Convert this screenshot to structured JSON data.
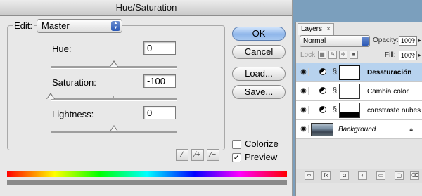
{
  "dialog": {
    "title": "Hue/Saturation",
    "edit_label": "Edit:",
    "edit_value": "Master",
    "hue_label": "Hue:",
    "hue_value": "0",
    "saturation_label": "Saturation:",
    "saturation_value": "-100",
    "lightness_label": "Lightness:",
    "lightness_value": "0",
    "slider_levels": {
      "hue": 0,
      "saturation": -100,
      "lightness": 0
    },
    "buttons": {
      "ok": "OK",
      "cancel": "Cancel",
      "load": "Load...",
      "save": "Save..."
    },
    "colorize_label": "Colorize",
    "colorize_checked": false,
    "preview_label": "Preview",
    "preview_checked": true,
    "check_mark": "✓"
  },
  "layers_panel": {
    "tab_label": "Layers",
    "tab_close": "×",
    "blend_mode": "Normal",
    "opacity_label": "Opacity:",
    "opacity_value": "100%",
    "lock_label": "Lock:",
    "fill_label": "Fill:",
    "fill_value": "100%",
    "layers": [
      {
        "name": "Desaturación",
        "selected": true
      },
      {
        "name": "Cambia color",
        "selected": false
      },
      {
        "name": "constraste nubes",
        "selected": false
      },
      {
        "name": "Background",
        "selected": false
      }
    ]
  },
  "colors": {
    "selected_row": "#b7d2ee",
    "default_button": "#8fb6ea",
    "dialog_bg": "#e8e8e8"
  }
}
